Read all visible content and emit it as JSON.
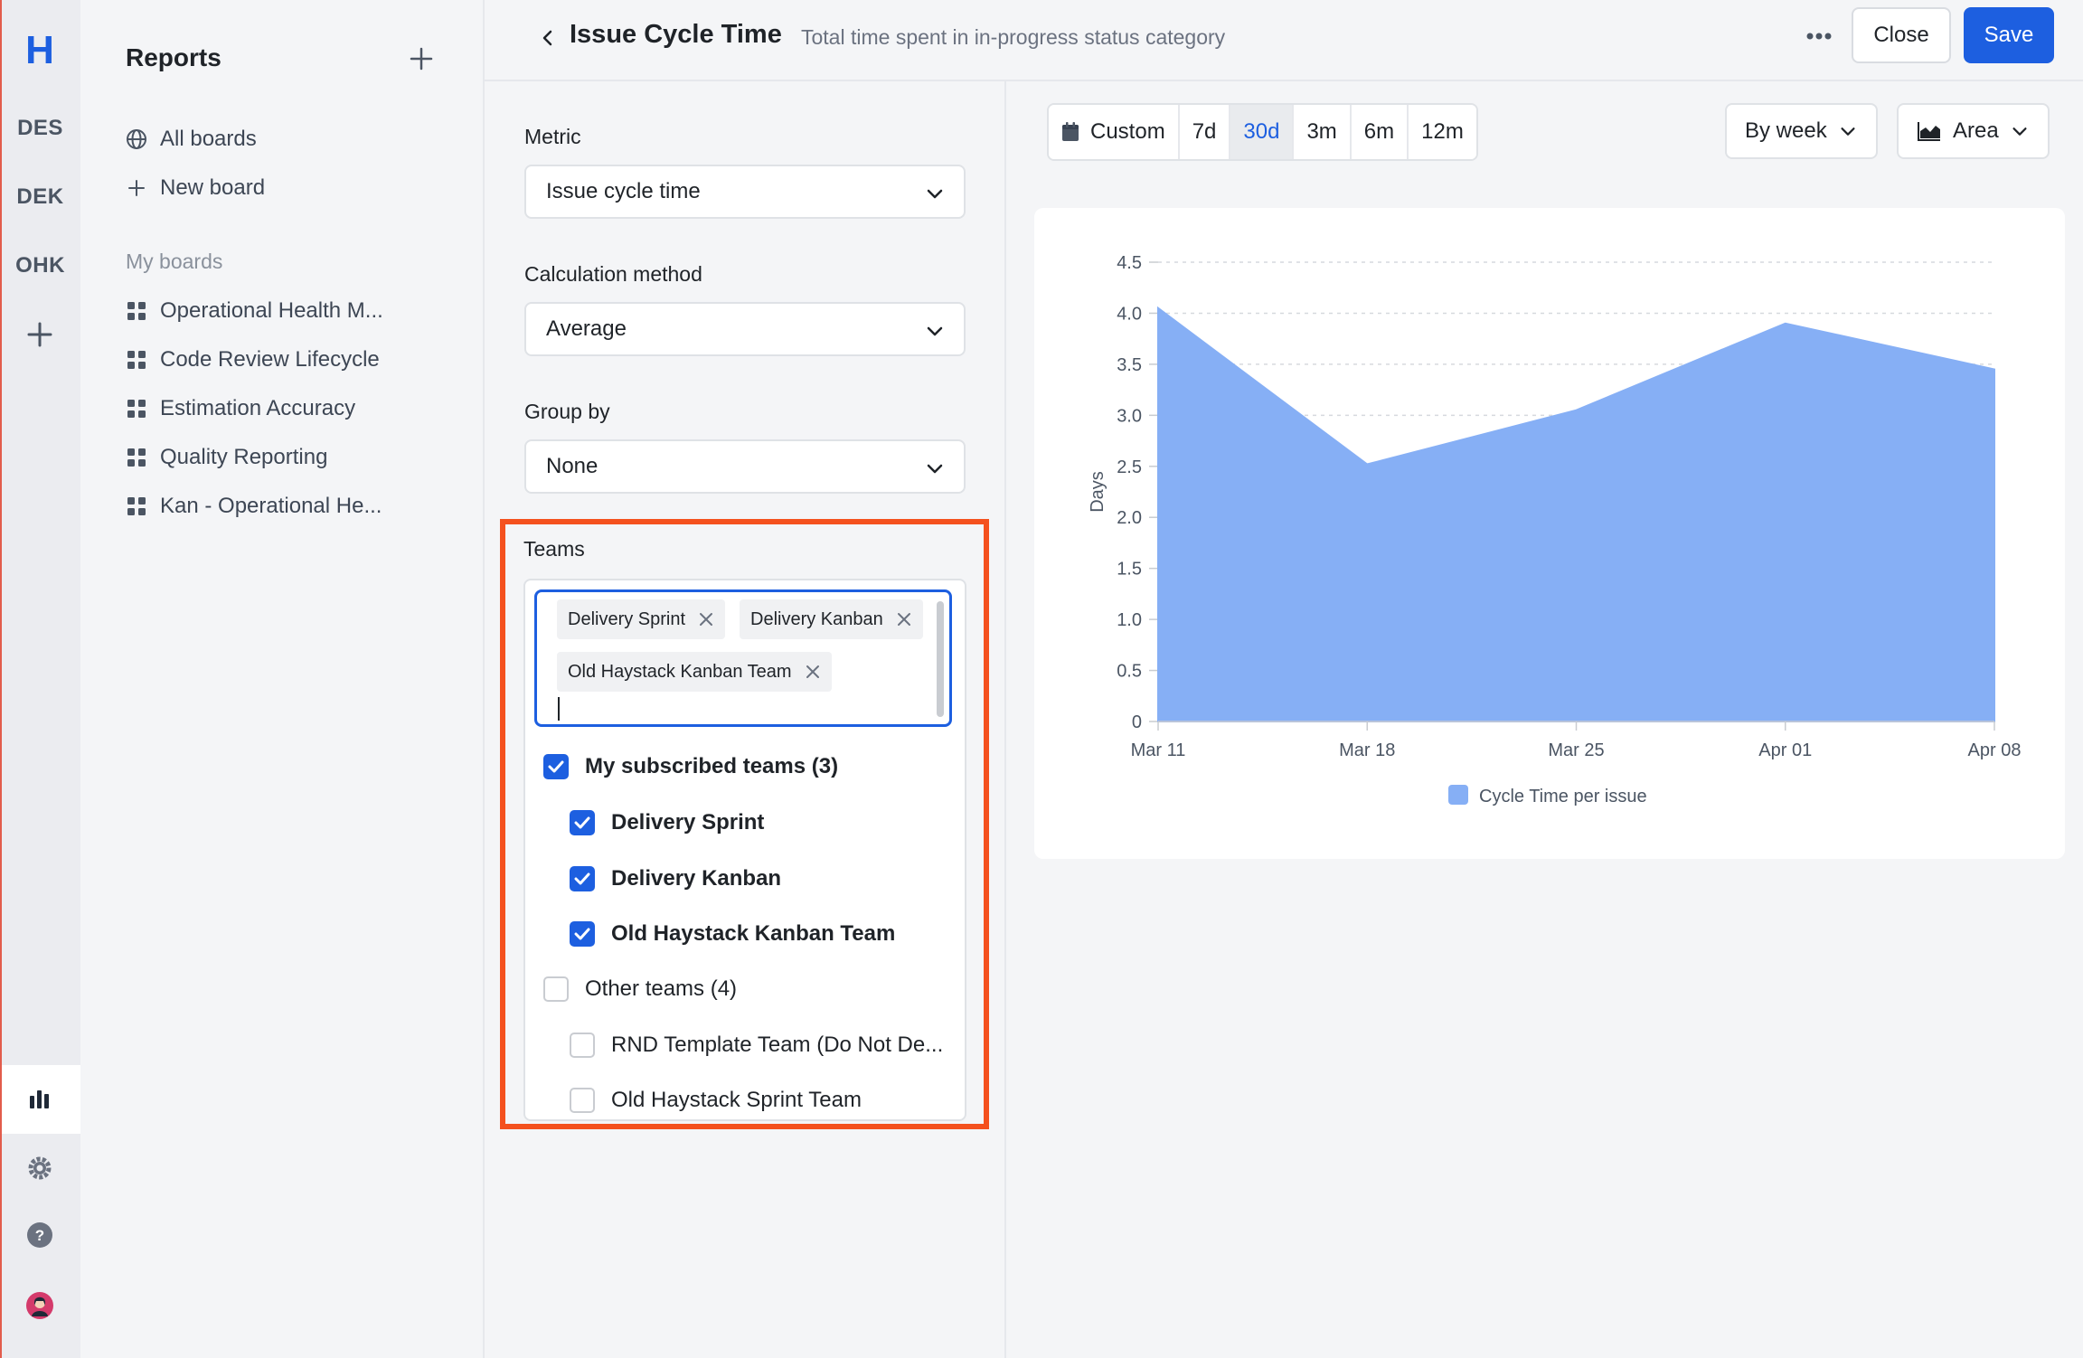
{
  "rail": {
    "logo": "H",
    "workspaces": [
      "DES",
      "DEK",
      "OHK"
    ]
  },
  "sidebar": {
    "title": "Reports",
    "all_boards": "All boards",
    "new_board": "New board",
    "section_label": "My boards",
    "boards": [
      "Operational Health M...",
      "Code Review Lifecycle",
      "Estimation Accuracy",
      "Quality Reporting",
      "Kan - Operational He..."
    ]
  },
  "header": {
    "title": "Issue Cycle Time",
    "subtitle": "Total time spent in in-progress status category",
    "close_label": "Close",
    "save_label": "Save"
  },
  "config": {
    "metric_label": "Metric",
    "metric_value": "Issue cycle time",
    "calc_label": "Calculation method",
    "calc_value": "Average",
    "group_label": "Group by",
    "group_value": "None",
    "teams_label": "Teams",
    "selected_tags": [
      "Delivery Sprint",
      "Delivery Kanban",
      "Old Haystack Kanban Team"
    ],
    "options": [
      {
        "label": "My subscribed teams (3)",
        "checked": true,
        "bold": true,
        "indent": 0
      },
      {
        "label": "Delivery Sprint",
        "checked": true,
        "bold": true,
        "indent": 1
      },
      {
        "label": "Delivery Kanban",
        "checked": true,
        "bold": true,
        "indent": 1
      },
      {
        "label": "Old Haystack Kanban Team",
        "checked": true,
        "bold": true,
        "indent": 1
      },
      {
        "label": "Other teams (4)",
        "checked": false,
        "bold": false,
        "indent": 0
      },
      {
        "label": "RND Template Team (Do Not De...",
        "checked": false,
        "bold": false,
        "indent": 1
      },
      {
        "label": "Old Haystack Sprint Team",
        "checked": false,
        "bold": false,
        "indent": 1
      }
    ]
  },
  "controls": {
    "ranges": [
      "Custom",
      "7d",
      "30d",
      "3m",
      "6m",
      "12m"
    ],
    "active_range": "30d",
    "interval_label": "By week",
    "chart_type_label": "Area"
  },
  "colors": {
    "accent": "#1d5fe0",
    "area_fill": "#86aff5",
    "highlight": "#f4511e"
  },
  "chart_data": {
    "type": "area",
    "x": [
      "Mar 11",
      "Mar 18",
      "Mar 25",
      "Apr 01",
      "Apr 08"
    ],
    "series": [
      {
        "name": "Cycle Time per issue",
        "values": [
          4.05,
          2.52,
          3.05,
          3.9,
          3.45
        ]
      }
    ],
    "ylabel": "Days",
    "ylim": [
      0,
      4.5
    ],
    "yticks": [
      "0",
      "0.5",
      "1.0",
      "1.5",
      "2.0",
      "2.5",
      "3.0",
      "3.5",
      "4.0",
      "4.5"
    ],
    "grid": true,
    "legend": "bottom-center"
  }
}
